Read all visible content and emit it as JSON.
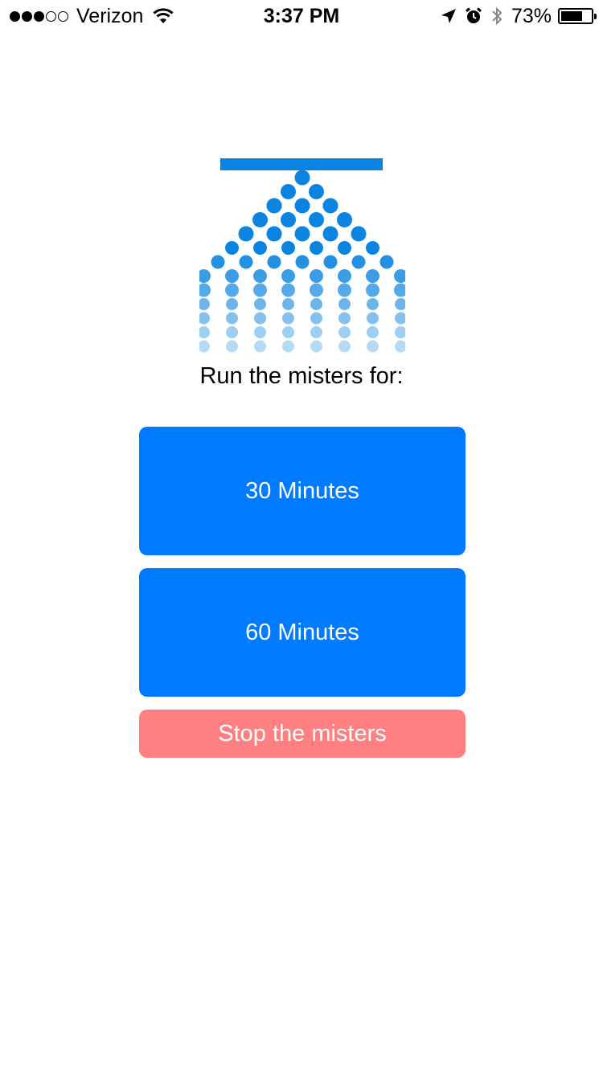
{
  "status_bar": {
    "signal_full": 3,
    "signal_empty": 2,
    "carrier": "Verizon",
    "wifi_icon": "wifi-icon",
    "time": "3:37 PM",
    "location_icon": "location-arrow-icon",
    "alarm_icon": "alarm-clock-icon",
    "bluetooth_icon": "bluetooth-icon",
    "battery_percent": "73%",
    "battery_level": 0.73
  },
  "mister_icon": {
    "name": "mister-spray-icon",
    "color": "#0a84e0"
  },
  "main": {
    "prompt": "Run the misters for:",
    "buttons": [
      {
        "label": "30 Minutes",
        "color": "#007aff"
      },
      {
        "label": "60 Minutes",
        "color": "#007aff"
      },
      {
        "label": "Stop the misters",
        "color": "#ff8080"
      }
    ]
  }
}
